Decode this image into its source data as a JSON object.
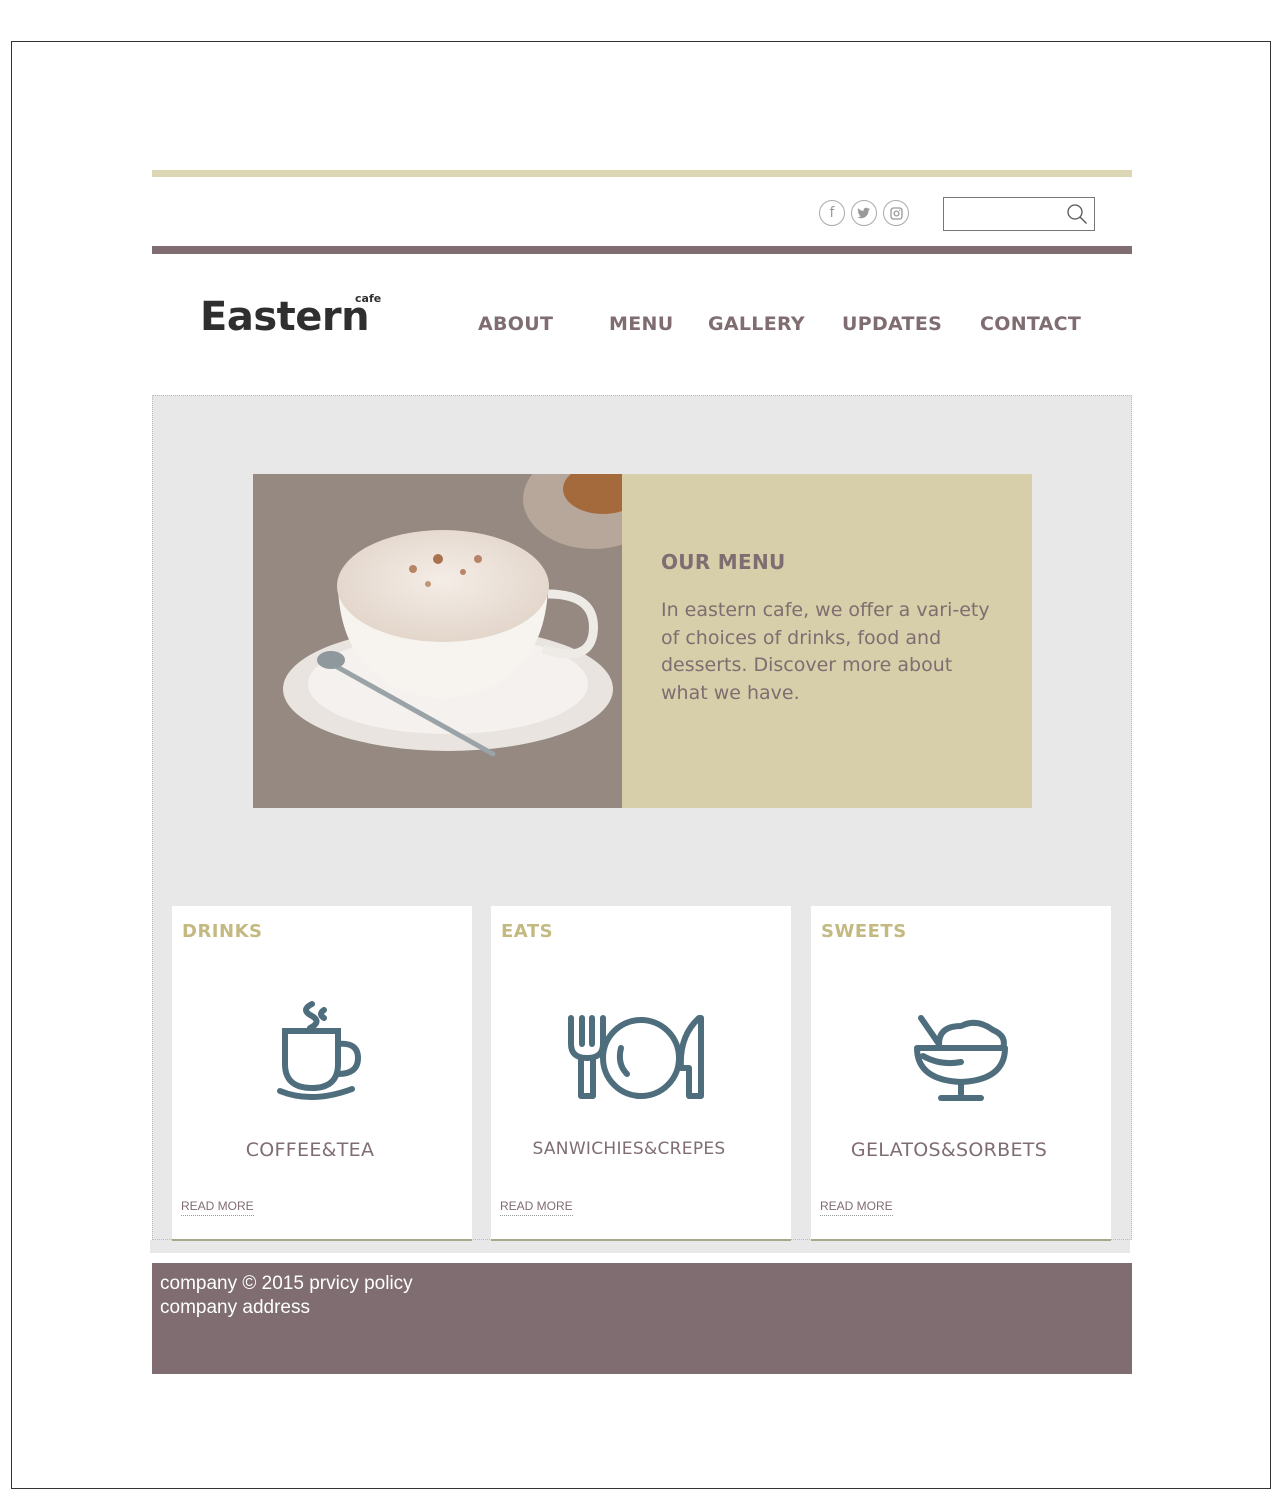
{
  "header": {
    "social": [
      {
        "icon": "facebook-icon",
        "glyph": "f"
      },
      {
        "icon": "twitter-icon",
        "glyph": "t"
      },
      {
        "icon": "instagram-icon",
        "glyph": "◘"
      }
    ],
    "search": {
      "placeholder": "",
      "value": ""
    }
  },
  "logo": {
    "word": "Eastern",
    "tag": "cafe"
  },
  "nav": {
    "items": [
      "ABOUT",
      "MENU",
      "GALLERY",
      "UPDATES",
      "CONTACT"
    ]
  },
  "feature": {
    "heading": "OUR MENU",
    "text": "In eastern cafe, we offer a vari-ety of choices of drinks, food and desserts. Discover more about what we have."
  },
  "cards": [
    {
      "title": "DRINKS",
      "name": "COFFEE&TEA",
      "read_more": "READ MORE",
      "icon": "coffee-cup-icon"
    },
    {
      "title": "EATS",
      "name": "SANWICHIES&CREPES",
      "read_more": "READ MORE",
      "icon": "fork-plate-knife-icon"
    },
    {
      "title": "SWEETS",
      "name": "GELATOS&SORBETS",
      "read_more": "READ MORE",
      "icon": "ice-cream-bowl-icon"
    }
  ],
  "footer": {
    "line1": "company © 2015 prvicy policy",
    "line2": "company address"
  },
  "colors": {
    "accent": "#7f6d71",
    "beige": "#d6cfa9",
    "gold": "#c4b981",
    "icon": "#4e6e7e"
  }
}
